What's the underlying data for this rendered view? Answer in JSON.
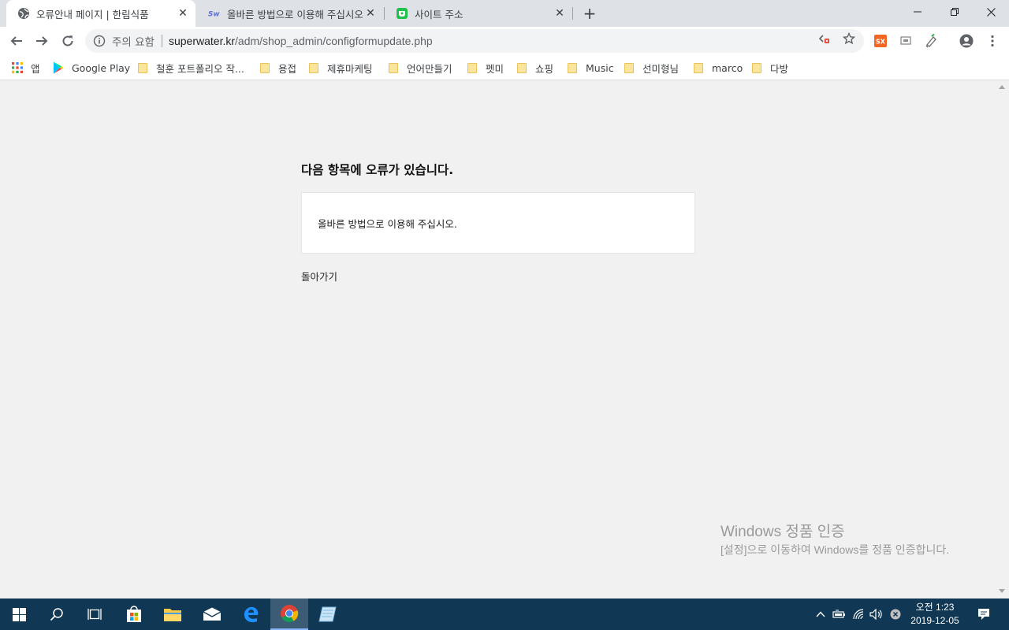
{
  "browser": {
    "tabs": [
      {
        "title": "오류안내 페이지 | 한림식품",
        "active": true
      },
      {
        "title": "올바른 방법으로 이용해 주십시오",
        "active": false
      },
      {
        "title": "사이트 주소",
        "active": false
      }
    ],
    "address_bar": {
      "security_label": "주의 요함",
      "url_host": "superwater.kr",
      "url_path": "/adm/shop_admin/configformupdate.php"
    },
    "bookmarks": [
      {
        "label": "앱",
        "icon": "apps-grid-icon"
      },
      {
        "label": "Google Play",
        "icon": "google-play-icon"
      },
      {
        "label": "철훈 포트폴리오 작...",
        "icon": "folder-icon"
      },
      {
        "label": "용접",
        "icon": "folder-icon"
      },
      {
        "label": "제휴마케팅",
        "icon": "folder-icon"
      },
      {
        "label": "언어만들기",
        "icon": "folder-icon"
      },
      {
        "label": "펫미",
        "icon": "folder-icon"
      },
      {
        "label": "쇼핑",
        "icon": "folder-icon"
      },
      {
        "label": "Music",
        "icon": "folder-icon"
      },
      {
        "label": "선미형님",
        "icon": "folder-icon"
      },
      {
        "label": "marco",
        "icon": "folder-icon"
      },
      {
        "label": "다방",
        "icon": "folder-icon"
      }
    ]
  },
  "page": {
    "heading": "다음 항목에 오류가 있습니다.",
    "message": "올바른 방법으로 이용해 주십시오.",
    "back_link": "돌아가기"
  },
  "watermark": {
    "title": "Windows 정품 인증",
    "body": "[설정]으로 이동하여 Windows를 정품 인증합니다."
  },
  "taskbar": {
    "time": "오전 1:23",
    "date": "2019-12-05"
  },
  "colors": {
    "taskbar": "#103754",
    "tab_strip": "#dee1e6",
    "page_background": "#f1f1f1"
  }
}
